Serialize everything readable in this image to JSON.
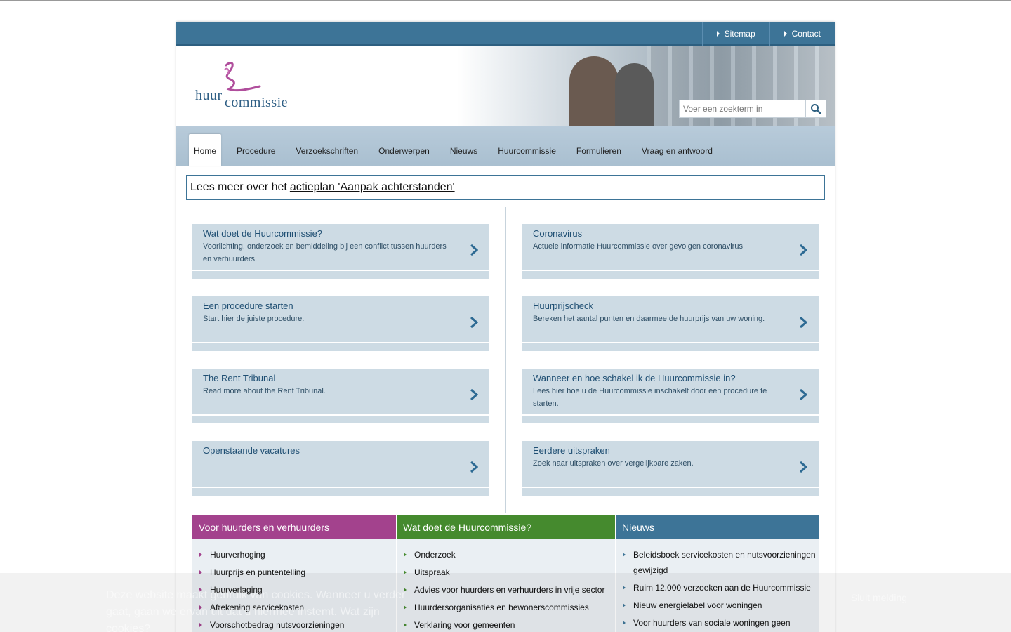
{
  "topbar": {
    "links": [
      {
        "label": "Sitemap"
      },
      {
        "label": "Contact"
      }
    ]
  },
  "header": {
    "logo_word1": "huur",
    "logo_word2": "commissie",
    "search_placeholder": "Voer een zoekterm in",
    "search_icon": "search-icon"
  },
  "nav": {
    "tabs": [
      {
        "label": "Home",
        "active": true
      },
      {
        "label": "Procedure"
      },
      {
        "label": "Verzoekschriften"
      },
      {
        "label": "Onderwerpen"
      },
      {
        "label": "Nieuws"
      },
      {
        "label": "Huurcommissie"
      },
      {
        "label": "Formulieren"
      },
      {
        "label": "Vraag en antwoord"
      }
    ]
  },
  "notice": {
    "prefix": "Lees meer over het",
    "link": "actieplan 'Aanpak achterstanden'"
  },
  "cards_left": [
    {
      "title": "Wat doet de Huurcommissie?",
      "desc": "Voorlichting, onderzoek en bemiddeling bij een conflict tussen huurders en verhuurders."
    },
    {
      "title": "Een procedure starten",
      "desc": "Start hier de juiste procedure."
    },
    {
      "title": "The Rent Tribunal",
      "desc": "Read more about the Rent Tribunal."
    },
    {
      "title": "Openstaande vacatures",
      "desc": ""
    }
  ],
  "cards_right": [
    {
      "title": "Coronavirus",
      "desc": "Actuele informatie Huurcommissie over gevolgen coronavirus"
    },
    {
      "title": "Huurprijscheck",
      "desc": "Bereken het aantal punten en daarmee de huurprijs van uw woning."
    },
    {
      "title": "Wanneer en hoe schakel ik de Huurcommissie in?",
      "desc": "Lees hier hoe u de Huurcommissie inschakelt door een procedure te starten."
    },
    {
      "title": "Eerdere uitspraken",
      "desc": "Zoek naar uitspraken over vergelijkbare zaken."
    }
  ],
  "bottom": {
    "col1": {
      "title": "Voor huurders en verhuurders",
      "color": "#a3428d",
      "items": [
        "Huurverhoging",
        "Huurprijs en puntentelling",
        "Huurverlaging",
        "Afrekening servicekosten",
        "Voorschotbedrag nutsvoorzieningen"
      ]
    },
    "col2": {
      "title": "Wat doet de Huurcommissie?",
      "color": "#458a2e",
      "items": [
        "Onderzoek",
        "Uitspraak",
        "Advies voor huurders en verhuurders in vrije sector",
        "Huurdersorganisaties en bewonerscommissies",
        "Verklaring voor gemeenten"
      ]
    },
    "col3": {
      "title": "Nieuws",
      "color": "#3d7497",
      "items": [
        "Beleidsboek servicekosten en nutsvoorzieningen gewijzigd",
        "Ruim 12.000 verzoeken aan de Huurcommissie",
        "Nieuw energielabel voor woningen",
        "Voor huurders van sociale woningen geen"
      ]
    }
  },
  "cookie": {
    "text": "Deze website maakt gebruik van cookies. Wanneer u verder gaat, gaan we ervan uit dat u hiermee instemt. Wat zijn cookies?",
    "button": "Sluit melding"
  },
  "colors": {
    "brand_blue": "#3d7497",
    "purple": "#a3428d",
    "green": "#458a2e",
    "card_bg": "#cddbe4"
  }
}
